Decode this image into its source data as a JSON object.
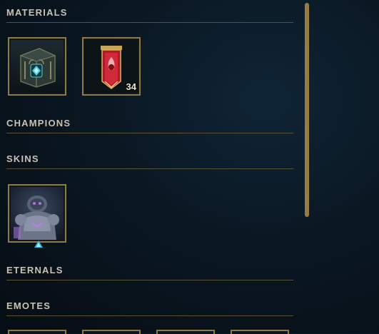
{
  "sections": {
    "materials": {
      "title": "MATERIALS"
    },
    "champions": {
      "title": "CHAMPIONS"
    },
    "skins": {
      "title": "SKINS"
    },
    "eternals": {
      "title": "ETERNALS"
    },
    "emotes": {
      "title": "EMOTES"
    }
  },
  "materials": [
    {
      "name": "hextech-chest",
      "icon": "hextech-chest-icon",
      "count": null
    },
    {
      "name": "mythic-essence-banner",
      "icon": "red-banner-icon",
      "count": "34"
    }
  ],
  "skins": [
    {
      "name": "champion-skin",
      "icon": "armored-champion-skin-icon",
      "selected": true
    }
  ],
  "colors": {
    "tile_border": "#8c7a49",
    "header_text": "#c8c3b4",
    "divider": "#5a5135",
    "scrollbar": "#9a7b42",
    "selection_indicator": "#37b2d6"
  }
}
